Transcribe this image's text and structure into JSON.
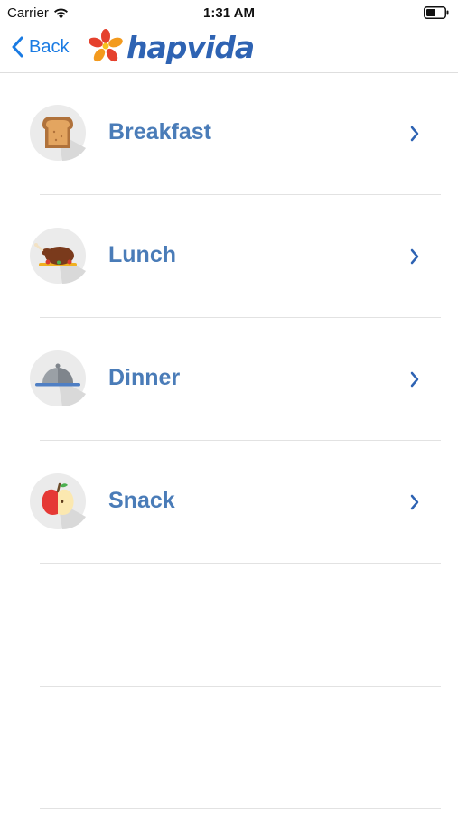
{
  "status_bar": {
    "carrier": "Carrier",
    "time": "1:31 AM",
    "wifi_icon": "wifi-icon",
    "battery_icon": "battery-icon"
  },
  "nav": {
    "back_label": "Back",
    "back_icon": "chevron-left-icon",
    "brand_text": "hapvida",
    "brand_colors": {
      "logo_text": "#2e63b3",
      "petal_red": "#e5412d",
      "petal_orange": "#f39a1e"
    }
  },
  "menu": {
    "items": [
      {
        "label": "Breakfast",
        "icon": "toast-icon"
      },
      {
        "label": "Lunch",
        "icon": "roast-chicken-icon"
      },
      {
        "label": "Dinner",
        "icon": "cloche-icon"
      },
      {
        "label": "Snack",
        "icon": "apple-icon"
      }
    ],
    "chevron_icon": "chevron-right-icon",
    "label_color": "#4a7cb8"
  }
}
